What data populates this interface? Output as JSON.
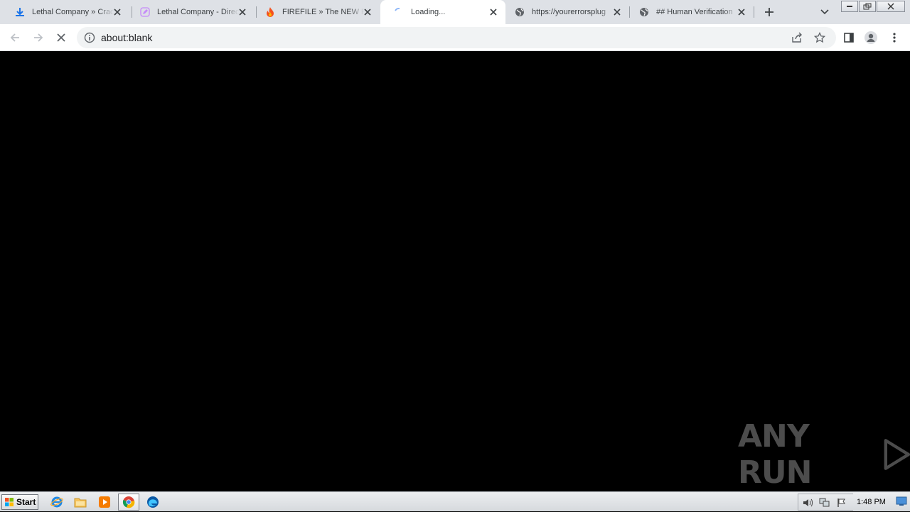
{
  "browser": {
    "tabs": [
      {
        "title": "Lethal Company » Crack",
        "icon": "download-icon"
      },
      {
        "title": "Lethal Company - Direct",
        "icon": "pencil-icon"
      },
      {
        "title": "FIREFILE » The NEW Fi",
        "icon": "flame-icon"
      },
      {
        "title": "Loading...",
        "icon": "loading-spinner-icon",
        "active": true
      },
      {
        "title": "https://yourerrorsplug",
        "icon": "globe-icon"
      },
      {
        "title": "## Human Verification",
        "icon": "globe-icon"
      }
    ],
    "address_bar": {
      "url": "about:blank"
    }
  },
  "watermark": {
    "text": "ANY RUN"
  },
  "taskbar": {
    "start_label": "Start",
    "pinned": [
      "internet-explorer-icon",
      "file-explorer-icon",
      "media-player-icon",
      "chrome-icon",
      "edge-icon"
    ],
    "clock": "1:48 PM"
  },
  "colors": {
    "tabstrip": "#dee1e6",
    "page_background": "#000000",
    "omnibox": "#f1f3f4"
  }
}
